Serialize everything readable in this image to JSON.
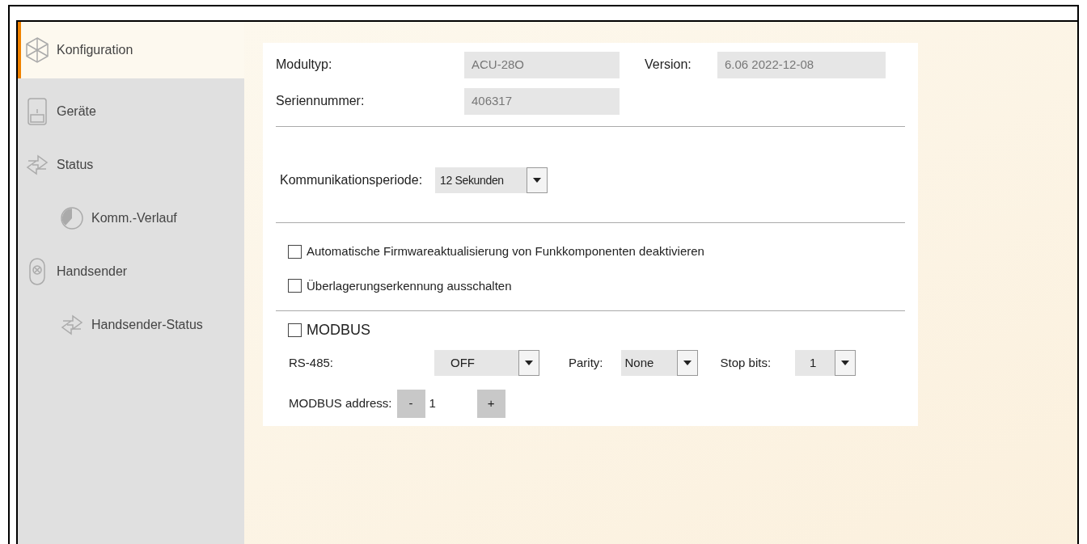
{
  "sidebar": {
    "items": [
      {
        "label": "Konfiguration",
        "kind": "config",
        "selected": true
      },
      {
        "label": "Geräte",
        "kind": "device",
        "selected": false
      },
      {
        "label": "Status",
        "kind": "arrows",
        "selected": false,
        "children": [
          {
            "label": "Komm.-Verlauf",
            "kind": "clock",
            "selected": false
          }
        ]
      },
      {
        "label": "Handsender",
        "kind": "remote",
        "selected": false,
        "children": [
          {
            "label": "Handsender-Status",
            "kind": "arrows",
            "selected": false
          }
        ]
      }
    ]
  },
  "module": {
    "modultyp_label": "Modultyp:",
    "modultyp": "ACU-28O",
    "version_label": "Version:",
    "version": "6.06 2022-12-08",
    "serial_label": "Seriennummer:",
    "serial": "406317"
  },
  "period": {
    "label": "Kommunikationsperiode:",
    "value": "12 Sekunden"
  },
  "options": [
    {
      "label": "Automatische Firmwareaktualisierung von Funkkomponenten deaktivieren",
      "checked": false
    },
    {
      "label": "Überlagerungserkennung ausschalten",
      "checked": false
    }
  ],
  "modbus": {
    "label": "MODBUS",
    "checked": false,
    "rs485_label": "RS-485:",
    "rs485": "OFF",
    "parity_label": "Parity:",
    "parity": "None",
    "stopbits_label": "Stop bits:",
    "stopbits": "1",
    "address_label": "MODBUS address:",
    "minus": "-",
    "address": "1",
    "plus": "+"
  }
}
